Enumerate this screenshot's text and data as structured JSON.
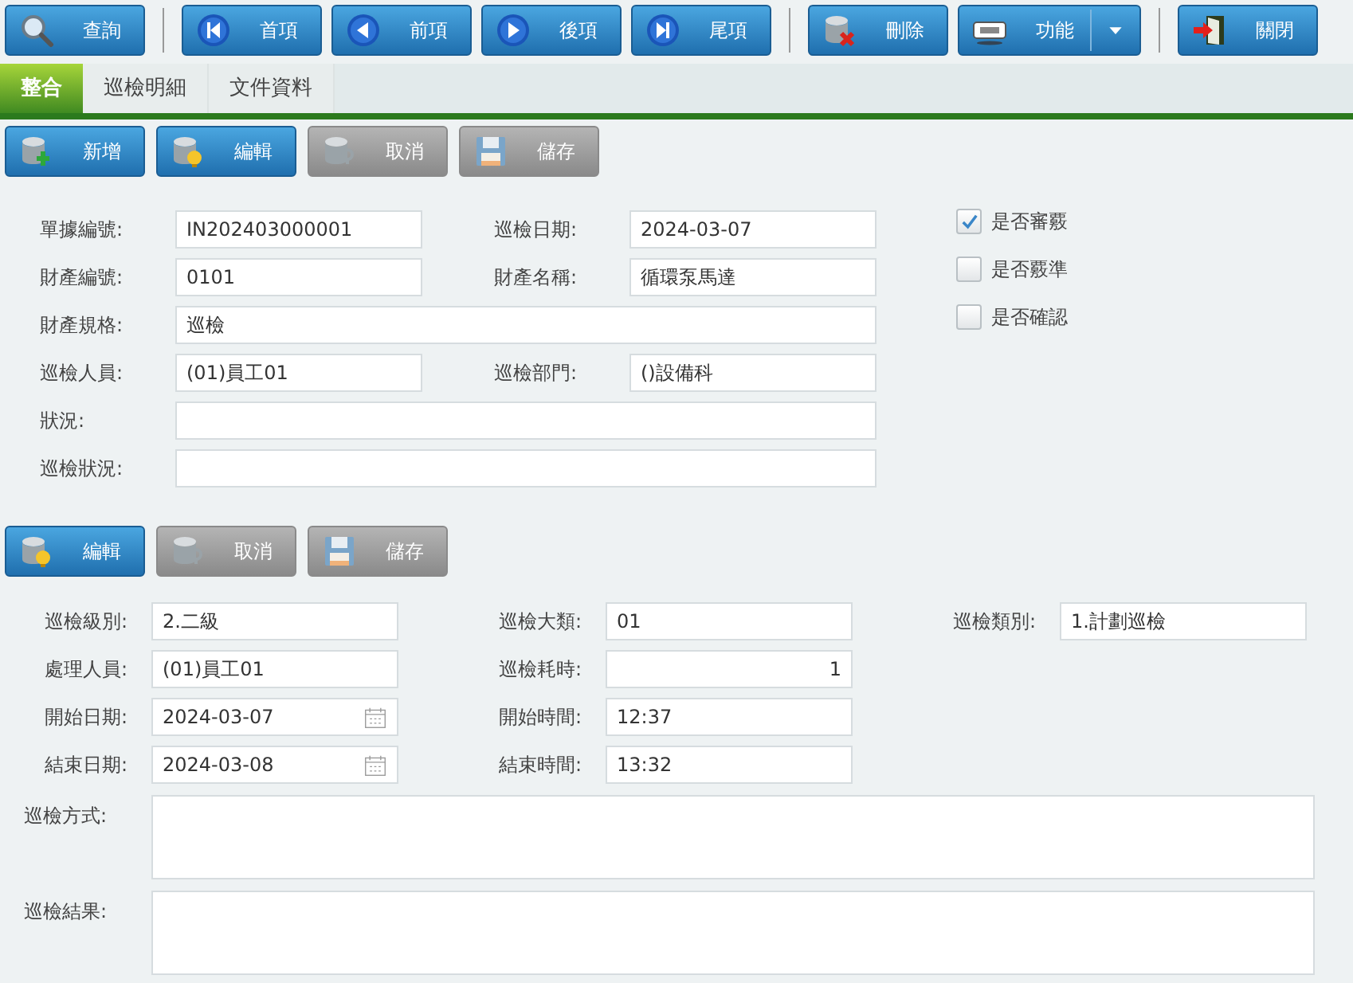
{
  "toolbar": [
    {
      "kind": "search",
      "label": "查詢"
    },
    {
      "kind": "separator"
    },
    {
      "kind": "first",
      "label": "首項"
    },
    {
      "kind": "prev",
      "label": "前項"
    },
    {
      "kind": "next",
      "label": "後項"
    },
    {
      "kind": "last",
      "label": "尾項"
    },
    {
      "kind": "separator"
    },
    {
      "kind": "delete",
      "label": "刪除"
    },
    {
      "kind": "abc",
      "label": "功能",
      "dropdown": true
    },
    {
      "kind": "separator"
    },
    {
      "kind": "exit",
      "label": "關閉"
    }
  ],
  "tabs": [
    {
      "label": "整合",
      "selected": true
    },
    {
      "label": "巡檢明細",
      "selected": false
    },
    {
      "label": "文件資料",
      "selected": false
    }
  ],
  "section_1": {
    "buttons": [
      {
        "kind": "add",
        "label": "新增",
        "disabled": false
      },
      {
        "kind": "edit",
        "label": "編輯",
        "disabled": false
      },
      {
        "kind": "cancel",
        "label": "取消",
        "disabled": true
      },
      {
        "kind": "save",
        "label": "儲存",
        "disabled": true
      }
    ],
    "rows": [
      [
        {
          "label": "單據編號:",
          "value": "IN202403000001",
          "kind": "text"
        },
        {
          "label": "巡檢日期:",
          "value": "2024-03-07",
          "kind": "text"
        }
      ],
      [
        {
          "label": "財產編號:",
          "value": "0101",
          "kind": "text"
        },
        {
          "label": "財產名稱:",
          "value": "循環泵馬達",
          "kind": "text"
        }
      ],
      [
        {
          "label": "財產規格:",
          "value": "巡檢",
          "kind": "wide"
        }
      ],
      [
        {
          "label": "巡檢人員:",
          "value": "(01)員工01",
          "kind": "text"
        },
        {
          "label": "巡檢部門:",
          "value": "()設備科",
          "kind": "text"
        }
      ],
      [
        {
          "label": "狀況:",
          "kind": "wide"
        }
      ],
      [
        {
          "label": "巡檢狀況:",
          "kind": "wide"
        }
      ]
    ],
    "checkboxes": [
      {
        "label": "是否審覈",
        "checked": true
      },
      {
        "label": "是否覈準",
        "checked": false
      },
      {
        "label": "是否確認",
        "checked": false
      }
    ]
  },
  "section_2": {
    "buttons": [
      {
        "kind": "edit",
        "label": "編輯",
        "disabled": false
      },
      {
        "kind": "cancel",
        "label": "取消",
        "disabled": true
      },
      {
        "kind": "save",
        "label": "儲存",
        "disabled": true
      }
    ],
    "rows": [
      [
        {
          "label": "巡檢級別:",
          "value": "2.二級",
          "kind": "text"
        },
        {
          "label": "巡檢大類:",
          "value": "01",
          "kind": "text"
        },
        {
          "label": "巡檢類別:",
          "value": "1.計劃巡檢",
          "kind": "text"
        }
      ],
      [
        {
          "label": "處理人員:",
          "value": "(01)員工01",
          "kind": "text"
        },
        {
          "label": "巡檢耗時:",
          "value": "1",
          "kind": "number"
        }
      ],
      [
        {
          "label": "開始日期:",
          "value": "2024-03-07",
          "kind": "date"
        },
        {
          "label": "開始時間:",
          "value": "12:37",
          "kind": "text"
        }
      ],
      [
        {
          "label": "結束日期:",
          "value": "2024-03-08",
          "kind": "date"
        },
        {
          "label": "結束時間:",
          "value": "13:32",
          "kind": "text"
        }
      ],
      [
        {
          "label": "巡檢方式:",
          "kind": "memo"
        }
      ],
      [
        {
          "label": "巡檢結果:",
          "kind": "memo"
        }
      ]
    ]
  }
}
